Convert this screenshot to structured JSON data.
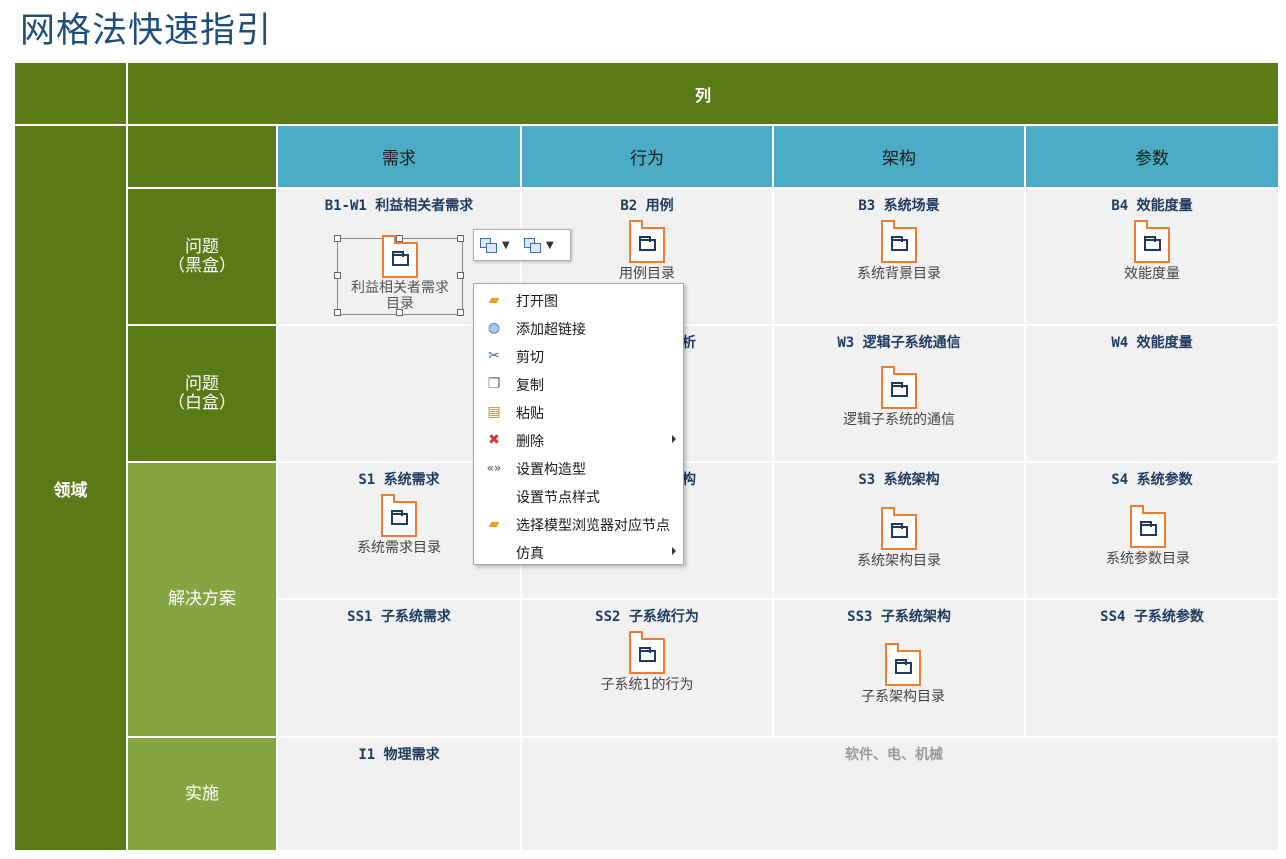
{
  "page_title": "网格法快速指引",
  "grid": {
    "column_header": "列",
    "row_header": "领域",
    "columns": [
      "需求",
      "行为",
      "架构",
      "参数"
    ],
    "rows": [
      {
        "label_line1": "问题",
        "label_line2": "（黑盒）"
      },
      {
        "label_line1": "问题",
        "label_line2": "（白盒）"
      },
      {
        "label_line1": "解决方案",
        "label_line2": ""
      },
      {
        "label_line1": "实施",
        "label_line2": ""
      }
    ],
    "cells": {
      "b1": {
        "title": "B1-W1  利益相关者需求",
        "item": "利益相关者需求目录"
      },
      "b2": {
        "title": "B2  用例",
        "item": "用例目录"
      },
      "b3": {
        "title": "B3  系统场景",
        "item": "系统背景目录"
      },
      "b4": {
        "title": "B4  效能度量",
        "item": "效能度量"
      },
      "w2": {
        "title": "析"
      },
      "w3": {
        "title": "W3  逻辑子系统通信",
        "item": "逻辑子系统的通信"
      },
      "w4": {
        "title": "W4  效能度量"
      },
      "s1": {
        "title": "S1  系统需求",
        "item": "系统需求目录"
      },
      "s2": {
        "title": "构"
      },
      "s3": {
        "title": "S3  系统架构",
        "item": "系统架构目录"
      },
      "s4": {
        "title": "S4  系统参数",
        "item": "系统参数目录"
      },
      "ss1": {
        "title": "SS1  子系统需求"
      },
      "ss2": {
        "title": "SS2  子系统行为",
        "item": "子系统1的行为"
      },
      "ss3": {
        "title": "SS3  子系统架构",
        "item": "子系架构目录"
      },
      "ss4": {
        "title": "SS4  子系统参数"
      },
      "i1": {
        "title": "I1  物理需求"
      },
      "i2": {
        "title": "软件、电、机械"
      }
    }
  },
  "selected_item_label_line1": "利益相关者需求",
  "selected_item_label_line2": "目录",
  "context_menu": {
    "items": [
      {
        "label": "打开图",
        "icon": "open-folder-icon"
      },
      {
        "label": "添加超链接",
        "icon": "globe-link-icon"
      },
      {
        "label": "剪切",
        "icon": "scissors-icon"
      },
      {
        "label": "复制",
        "icon": "copy-icon"
      },
      {
        "label": "粘贴",
        "icon": "paste-icon"
      },
      {
        "label": "删除",
        "icon": "delete-x-icon",
        "submenu": true
      },
      {
        "label": "设置构造型",
        "icon": "stereotype-icon"
      },
      {
        "label": "设置节点样式",
        "icon": ""
      },
      {
        "label": "选择模型浏览器对应节点",
        "icon": "open-folder-icon"
      },
      {
        "label": "仿真",
        "icon": "",
        "submenu": true
      }
    ]
  },
  "colors": {
    "dark_green": "#5a7a18",
    "light_green": "#84a541",
    "header_blue": "#4bacc6",
    "title_blue": "#1f4e79",
    "package_orange": "#ed7d31"
  }
}
